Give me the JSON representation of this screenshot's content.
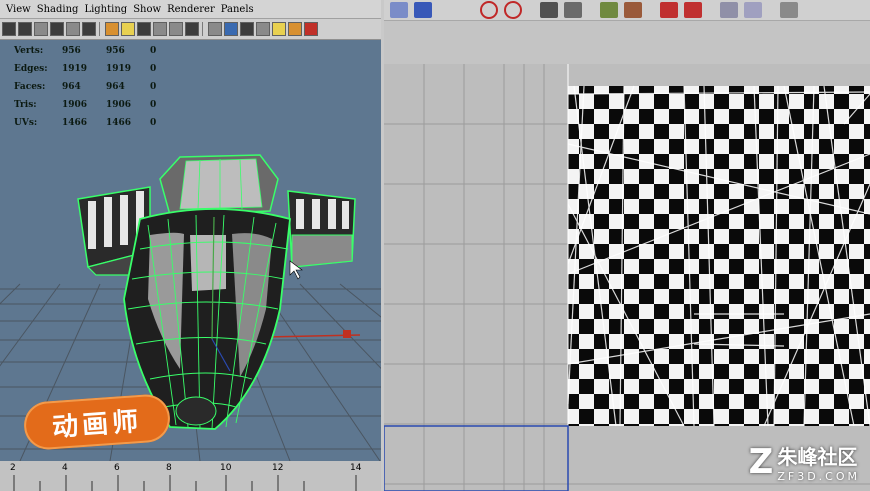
{
  "viewport": {
    "menu": [
      "View",
      "Shading",
      "Lighting",
      "Show",
      "Renderer",
      "Panels"
    ],
    "hud": [
      {
        "label": "Verts:",
        "v1": "956",
        "v2": "956",
        "v3": "0"
      },
      {
        "label": "Edges:",
        "v1": "1919",
        "v2": "1919",
        "v3": "0"
      },
      {
        "label": "Faces:",
        "v1": "964",
        "v2": "964",
        "v3": "0"
      },
      {
        "label": "Tris:",
        "v1": "1906",
        "v2": "1906",
        "v3": "0"
      },
      {
        "label": "UVs:",
        "v1": "1466",
        "v2": "1466",
        "v3": "0"
      }
    ],
    "timeline_ticks": [
      "2",
      "4",
      "6",
      "8",
      "10",
      "12",
      "14"
    ],
    "logo_text": "动画师"
  },
  "uv_editor": {
    "watermark_cn": "朱峰社区",
    "watermark_en": "ZF3D.COM"
  },
  "colors": {
    "viewport_bg": "#5e7790",
    "wireframe": "#39ff6a",
    "logo": "#e36b1a",
    "uv_bg": "#bdbdbd"
  }
}
